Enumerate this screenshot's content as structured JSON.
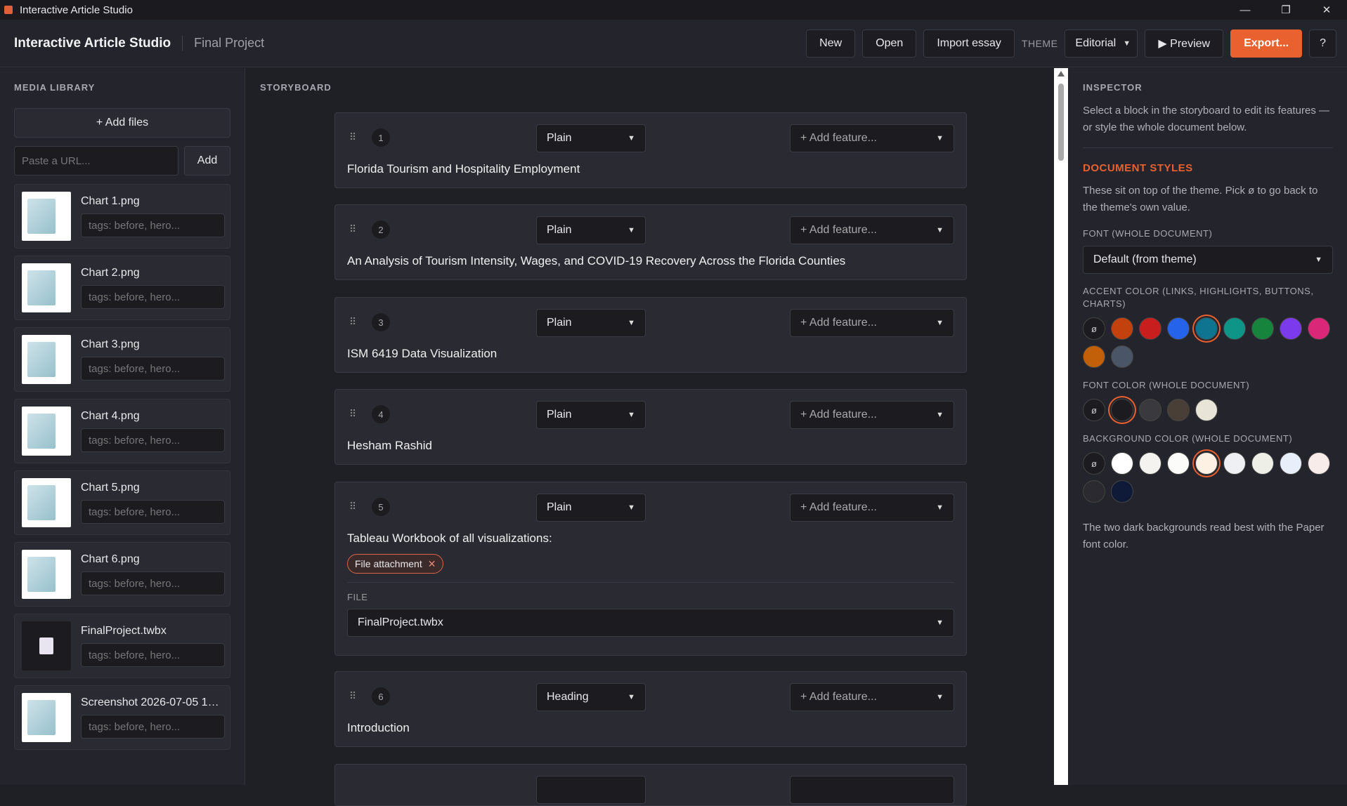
{
  "window": {
    "title": "Interactive Article Studio"
  },
  "appbar": {
    "brand": "Interactive Article Studio",
    "project": "Final Project",
    "new": "New",
    "open": "Open",
    "import": "Import essay",
    "theme_label": "THEME",
    "theme_value": "Editorial",
    "preview": "▶ Preview",
    "export": "Export...",
    "help": "?"
  },
  "media": {
    "title": "MEDIA LIBRARY",
    "add_files": "+ Add files",
    "url_placeholder": "Paste a URL...",
    "add": "Add",
    "tag_placeholder": "tags: before, hero...",
    "items": [
      {
        "name": "Chart 1.png"
      },
      {
        "name": "Chart 2.png"
      },
      {
        "name": "Chart 3.png"
      },
      {
        "name": "Chart 4.png"
      },
      {
        "name": "Chart 5.png"
      },
      {
        "name": "Chart 6.png"
      },
      {
        "name": "FinalProject.twbx"
      },
      {
        "name": "Screenshot 2026-07-05 192..."
      }
    ]
  },
  "storyboard": {
    "title": "STORYBOARD",
    "add_feature": "+ Add feature...",
    "blocks": [
      {
        "num": "1",
        "type": "Plain",
        "text": "Florida Tourism and Hospitality Employment"
      },
      {
        "num": "2",
        "type": "Plain",
        "text": "An Analysis of Tourism Intensity, Wages, and COVID-19 Recovery Across the Florida Counties"
      },
      {
        "num": "3",
        "type": "Plain",
        "text": "ISM 6419 Data Visualization"
      },
      {
        "num": "4",
        "type": "Plain",
        "text": "Hesham Rashid"
      },
      {
        "num": "5",
        "type": "Plain",
        "text": "Tableau Workbook of all visualizations:",
        "chip": "File attachment",
        "file_label": "FILE",
        "file_value": "FinalProject.twbx"
      },
      {
        "num": "6",
        "type": "Heading",
        "text": "Introduction"
      }
    ]
  },
  "inspector": {
    "title": "INSPECTOR",
    "hint": "Select a block in the storyboard to edit its features — or style the whole document below.",
    "doc_styles": "DOCUMENT STYLES",
    "doc_hint": "These sit on top of the theme. Pick ø to go back to the theme's own value.",
    "font_label": "FONT (WHOLE DOCUMENT)",
    "font_value": "Default (from theme)",
    "accent_label": "ACCENT COLOR (LINKS, HIGHLIGHTS, BUTTONS, CHARTS)",
    "fontcolor_label": "FONT COLOR (WHOLE DOCUMENT)",
    "bg_label": "BACKGROUND COLOR (WHOLE DOCUMENT)",
    "none_symbol": "ø",
    "footer": "The two dark backgrounds read best with the Paper font color.",
    "accent_colors": [
      "#c2410c",
      "#c81e1e",
      "#2563eb",
      "#0e7490",
      "#0f9488",
      "#16843c",
      "#7c3aed",
      "#db2777",
      "#c2600a",
      "#4b5568"
    ],
    "font_colors": [
      "#1b1b20",
      "#3a3a3e",
      "#4a3f36",
      "#e8e4d8"
    ],
    "bg_colors": [
      "#ffffff",
      "#f4f3ef",
      "#fbfbf9",
      "#fdf1e4",
      "#eef0f4",
      "#eef0e8",
      "#e8eefa",
      "#f8ecea",
      "#2a2a30",
      "#0f1a38"
    ]
  }
}
